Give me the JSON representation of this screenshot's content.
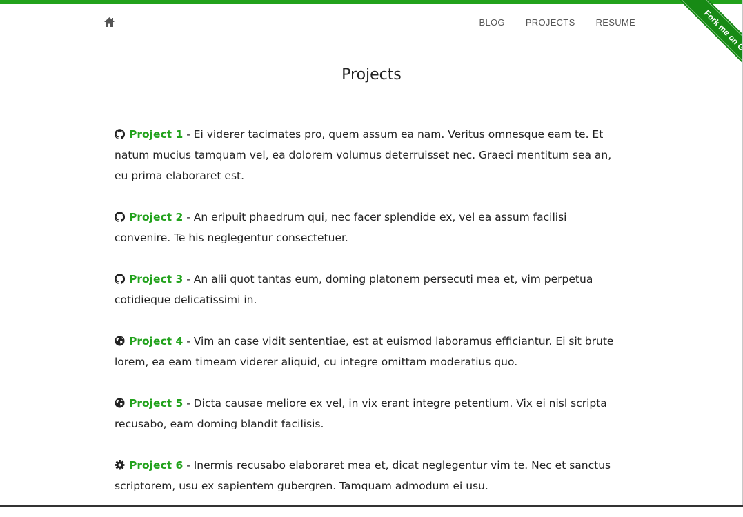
{
  "nav": {
    "home_icon": "home-icon",
    "links": [
      "BLOG",
      "PROJECTS",
      "RESUME"
    ]
  },
  "ribbon": {
    "label": "Fork me on GitHub"
  },
  "page": {
    "title": "Projects"
  },
  "projects": [
    {
      "icon": "github-icon",
      "name": "Project 1",
      "description": " - Ei viderer tacimates pro, quem assum ea nam. Veritus omnesque eam te. Et natum mucius tamquam vel, ea dolorem volumus deterruisset nec. Graeci mentitum sea an, eu prima elaboraret est."
    },
    {
      "icon": "github-icon",
      "name": "Project 2",
      "description": " - An eripuit phaedrum qui, nec facer splendide ex, vel ea assum facilisi convenire. Te his neglegentur consectetuer."
    },
    {
      "icon": "github-icon",
      "name": "Project 3",
      "description": " - An alii quot tantas eum, doming platonem persecuti mea et, vim perpetua cotidieque delicatissimi in."
    },
    {
      "icon": "globe-icon",
      "name": "Project 4",
      "description": " - Vim an case vidit sententiae, est at euismod laboramus efficiantur. Ei sit brute lorem, ea eam timeam viderer aliquid, cu integre omittam moderatius quo."
    },
    {
      "icon": "globe-icon",
      "name": "Project 5",
      "description": " - Dicta causae meliore ex vel, in vix erant integre petentium. Vix ei nisl scripta recusabo, eam doming blandit facilisis."
    },
    {
      "icon": "gear-icon",
      "name": "Project 6",
      "description": " - Inermis recusabo elaboraret mea et, dicat neglegentur vim te. Nec et sanctus scriptorem, usu ex sapientem gubergren. Tamquam admodum ei usu."
    }
  ],
  "colors": {
    "accent": "#22a21c",
    "ribbon": "#178a15",
    "text": "#222222",
    "nav_text": "#555555"
  }
}
